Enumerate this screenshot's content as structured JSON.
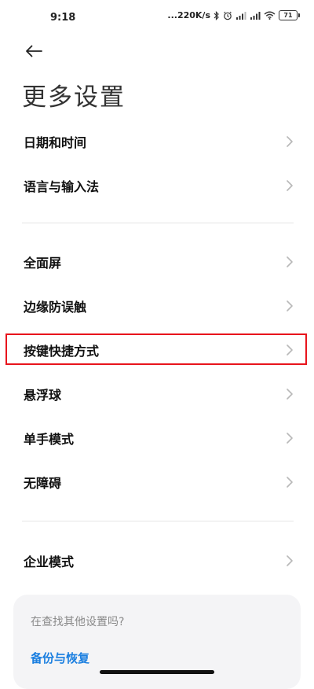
{
  "status_bar": {
    "time": "9:18",
    "network_speed": "...220K/s",
    "battery": "71"
  },
  "header": {
    "back_icon": "arrow-left-icon",
    "title": "更多设置"
  },
  "groups": [
    {
      "items": [
        {
          "label": "日期和时间"
        },
        {
          "label": "语言与输入法"
        }
      ]
    },
    {
      "items": [
        {
          "label": "全面屏"
        },
        {
          "label": "边缘防误触"
        },
        {
          "label": "按键快捷方式",
          "highlighted": true
        },
        {
          "label": "悬浮球"
        },
        {
          "label": "单手模式"
        },
        {
          "label": "无障碍"
        }
      ]
    },
    {
      "items": [
        {
          "label": "企业模式"
        }
      ]
    }
  ],
  "search_card": {
    "prompt": "在查找其他设置吗?",
    "link": "备份与恢复"
  },
  "colors": {
    "highlight_border": "#e8141c",
    "link": "#1b7fe0",
    "card_background": "#f4f4f6"
  }
}
